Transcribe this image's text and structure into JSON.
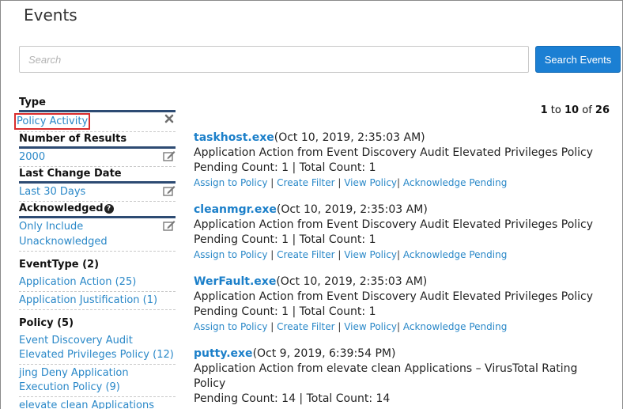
{
  "page": {
    "title": "Events"
  },
  "search": {
    "placeholder": "Search",
    "value": "",
    "button_label": "Search Events"
  },
  "sidebar": {
    "type": {
      "title": "Type",
      "value": "Policy Activity"
    },
    "number_of_results": {
      "title": "Number of Results",
      "value": "2000"
    },
    "last_change_date": {
      "title": "Last Change Date",
      "value": "Last 30 Days"
    },
    "acknowledged": {
      "title": "Acknowledged",
      "value_line1": "Only Include",
      "value_line2": "Unacknowledged"
    },
    "event_type": {
      "title": "EventType (2)",
      "items": [
        "Application Action (25)",
        "Application Justification (1)"
      ]
    },
    "policy": {
      "title": "Policy (5)",
      "items": [
        {
          "line1": "Event Discovery Audit",
          "line2": "Elevated Privileges Policy (12)"
        },
        {
          "line1": "jing Deny Application",
          "line2": "Execution Policy (9)"
        },
        {
          "line1": "elevate clean Applications",
          "line2": ""
        }
      ]
    }
  },
  "pagination": {
    "from": "1",
    "to_word": "to",
    "to": "10",
    "of_word": "of",
    "total": "26"
  },
  "actions": {
    "assign": "Assign to Policy",
    "filter": "Create Filter",
    "view": "View Policy",
    "acknowledge": "Acknowledge Pending",
    "sep": " | ",
    "sep_short": "| "
  },
  "events": [
    {
      "name": "taskhost.exe",
      "date": "(Oct 10, 2019, 2:35:03 AM)",
      "description": "Application Action from Event Discovery Audit Elevated Privileges Policy",
      "counts": "Pending Count: 1 | Total Count: 1"
    },
    {
      "name": "cleanmgr.exe",
      "date": "(Oct 10, 2019, 2:35:03 AM)",
      "description": "Application Action from Event Discovery Audit Elevated Privileges Policy",
      "counts": "Pending Count: 1 | Total Count: 1"
    },
    {
      "name": "WerFault.exe",
      "date": "(Oct 10, 2019, 2:35:03 AM)",
      "description": "Application Action from Event Discovery Audit Elevated Privileges Policy",
      "counts": "Pending Count: 1 | Total Count: 1"
    },
    {
      "name": "putty.exe",
      "date": "(Oct 9, 2019, 6:39:54 PM)",
      "description": "Application Action from elevate clean Applications – VirusTotal Rating Policy",
      "counts": "Pending Count: 14 | Total Count: 14"
    }
  ],
  "colors": {
    "accent": "#1b7fd3",
    "link": "#2a88c8",
    "filter_bar": "#2d4b73",
    "highlight": "#d92d2d"
  },
  "icons": {
    "remove": "times-icon",
    "edit": "edit-icon",
    "help": "help-circle-icon"
  }
}
